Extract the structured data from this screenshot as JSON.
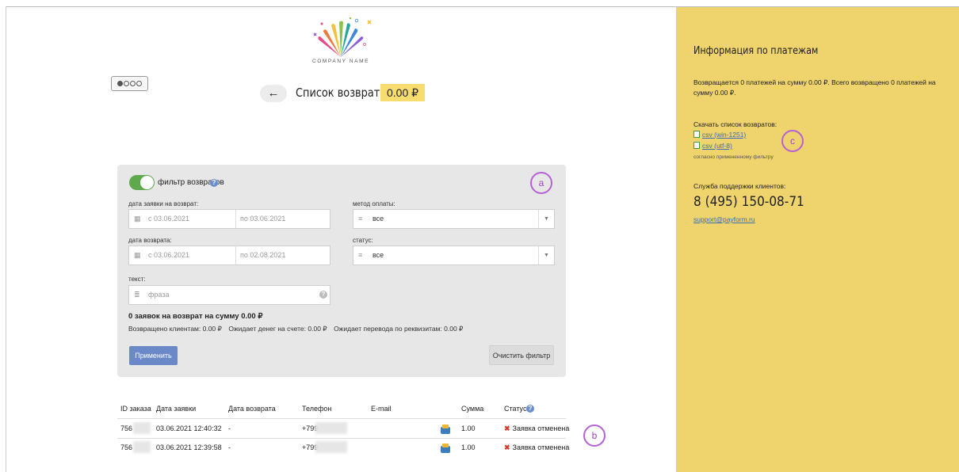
{
  "brand": {
    "logo_text": "COMPANY NAME"
  },
  "header": {
    "back_label": "←",
    "title": "Список возвратов",
    "total": "0.00 ₽"
  },
  "filter": {
    "toggle_label": "фильтр возвратов",
    "request_date_label": "дата заявки на возврат:",
    "request_date_from": "с 03.06.2021",
    "request_date_to": "по 03.06.2021",
    "payment_method_label": "метод оплаты:",
    "payment_method_value": "все",
    "refund_date_label": "дата возврата:",
    "refund_date_from": "с 03.06.2021",
    "refund_date_to": "по 02.08.2021",
    "status_label": "статус:",
    "status_value": "все",
    "text_label": "текст:",
    "text_placeholder": "фраза",
    "summary_bold": "0 заявок на возврат на сумму 0.00 ₽",
    "returned_to_clients": "Возвращено клиентам: 0.00 ₽",
    "awaiting_funds": "Ожидает денег на счете: 0.00 ₽",
    "awaiting_transfer": "Ожидает перевода по реквизитам: 0.00 ₽",
    "apply_label": "Применить",
    "clear_label": "Очистить фильтр"
  },
  "table": {
    "headers": [
      "ID заказа",
      "Дата заявки",
      "Дата возврата",
      "Телефон",
      "E-mail",
      "Сумма",
      "Статус"
    ],
    "rows": [
      {
        "id": "756",
        "request_date": "03.06.2021 12:40:32",
        "refund_date": "-",
        "phone": "+799",
        "amount": "1.00",
        "status": "Заявка отменена",
        "status_icon": "✖"
      },
      {
        "id": "756",
        "request_date": "03.06.2021 12:39:58",
        "refund_date": "-",
        "phone": "+799",
        "amount": "1.00",
        "status": "Заявка отменена",
        "status_icon": "✖"
      }
    ]
  },
  "annotations": {
    "a": "a",
    "b": "b",
    "c": "c"
  },
  "info": {
    "title": "Информация по платежам",
    "summary": "Возвращается 0 платежей на сумму 0.00 ₽. Всего возвращено 0 платежей на сумму 0.00 ₽.",
    "download_label": "Скачать список возвратов:",
    "csv_win": "csv (win-1251)",
    "csv_utf": "csv (utf-8)",
    "filter_note": "согласно примененному фильтру",
    "support_label": "Служба поддержки клиентов:",
    "phone": "8 (495) 150-08-71",
    "email": "support@payform.ru"
  },
  "colors": {
    "accent_yellow": "#efd36d",
    "apply_blue": "#6b89c8",
    "toggle_green": "#5fa94d",
    "annotation_purple": "#b561d8"
  }
}
